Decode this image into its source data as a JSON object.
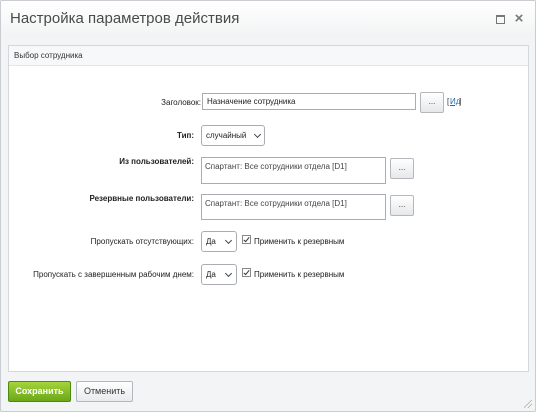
{
  "dialog": {
    "title": "Настройка параметров действия"
  },
  "panel": {
    "title": "Выбор сотрудника"
  },
  "form": {
    "heading_label": "Заголовок:",
    "heading_value": "Назначение сотрудника",
    "heading_dots": "...",
    "heading_link_open": "[",
    "heading_link": "Ид",
    "heading_link_close": "]",
    "type_label": "Тип:",
    "type_value": "случайный",
    "from_users_label": "Из пользователей:",
    "from_users_value": "Спартант: Все сотрудники отдела [D1]",
    "from_users_dots": "...",
    "reserve_label": "Резервные пользователи:",
    "reserve_value": "Спартант: Все сотрудники отдела [D1]",
    "reserve_dots": "...",
    "skip_absent_label": "Пропускать отсутствующих:",
    "skip_absent_value": "Да",
    "skip_absent_checkbox_label": "Применить к резервным",
    "skip_finished_label": "Пропускать с завершенным рабочим днем:",
    "skip_finished_value": "Да",
    "skip_finished_checkbox_label": "Применить к резервным"
  },
  "footer": {
    "save_label": "Сохранить",
    "cancel_label": "Отменить"
  }
}
